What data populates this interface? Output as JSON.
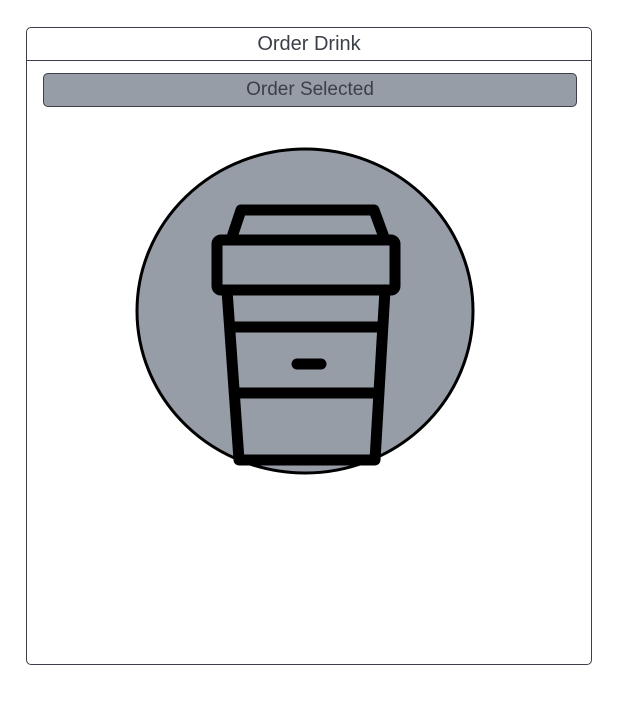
{
  "panel": {
    "title": "Order Drink"
  },
  "order_button": {
    "label": "Order Selected"
  },
  "drink": {
    "icon": "coffee-cup-icon"
  },
  "colors": {
    "button_fill": "#979da7",
    "circle_fill": "#979da7",
    "text": "#3b3f47",
    "border": "#3b3f47",
    "icon_stroke": "#000000"
  }
}
